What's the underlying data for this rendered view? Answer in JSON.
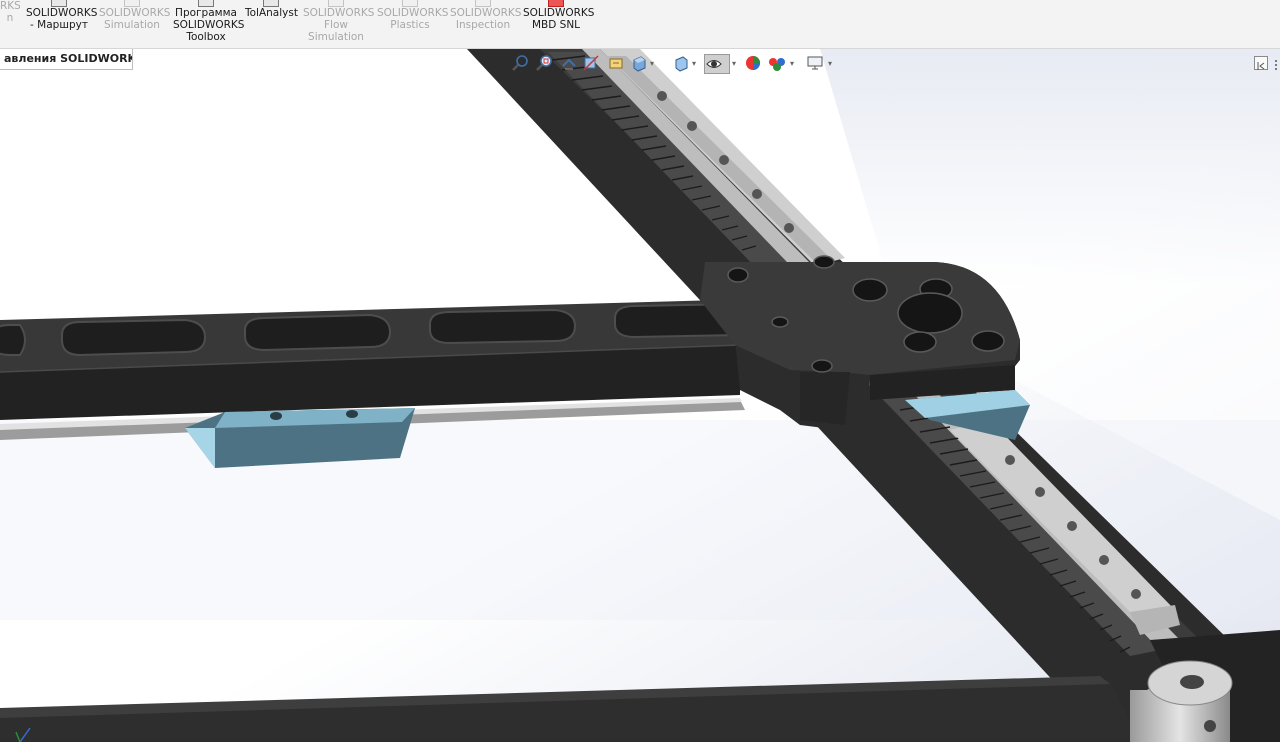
{
  "ribbon": {
    "items": [
      {
        "id": "truncated",
        "lines": [
          "RKS",
          "n"
        ],
        "enabled": false
      },
      {
        "id": "routing",
        "lines": [
          "SOLIDWORKS",
          "- Маршрут"
        ],
        "enabled": true
      },
      {
        "id": "simulation",
        "lines": [
          "SOLIDWORKS",
          "Simulation"
        ],
        "enabled": false
      },
      {
        "id": "toolbox",
        "lines": [
          "Программа",
          "SOLIDWORKS",
          "Toolbox"
        ],
        "enabled": true
      },
      {
        "id": "tolanalyst",
        "lines": [
          "TolAnalyst"
        ],
        "enabled": true
      },
      {
        "id": "flow",
        "lines": [
          "SOLIDWORKS",
          "Flow",
          "Simulation"
        ],
        "enabled": false
      },
      {
        "id": "plastics",
        "lines": [
          "SOLIDWORKS",
          "Plastics"
        ],
        "enabled": false
      },
      {
        "id": "inspection",
        "lines": [
          "SOLIDWORKS",
          "Inspection"
        ],
        "enabled": false
      },
      {
        "id": "mbd",
        "lines": [
          "SOLIDWORKS",
          "MBD SNL"
        ],
        "enabled": true
      }
    ]
  },
  "document_tab": {
    "label": "авления SOLIDWORKS"
  },
  "headsup_toolbar": {
    "icons": [
      "zoom-to-fit-icon",
      "zoom-to-area-icon",
      "previous-view-icon",
      "section-view-icon",
      "dynamic-annotation-icon",
      "view-orientation-icon",
      "display-style-icon",
      "hide-show-items-icon",
      "edit-appearance-icon",
      "apply-scene-icon",
      "view-settings-icon"
    ]
  },
  "colors": {
    "frame_dark": "#2b2b2b",
    "frame_top": "#3a3a3a",
    "rail_silver": "#c9c9c9",
    "carriage_blue": "#4d7284",
    "carriage_light": "#9fd0e3",
    "background_gradient": "#e6e9f2"
  }
}
